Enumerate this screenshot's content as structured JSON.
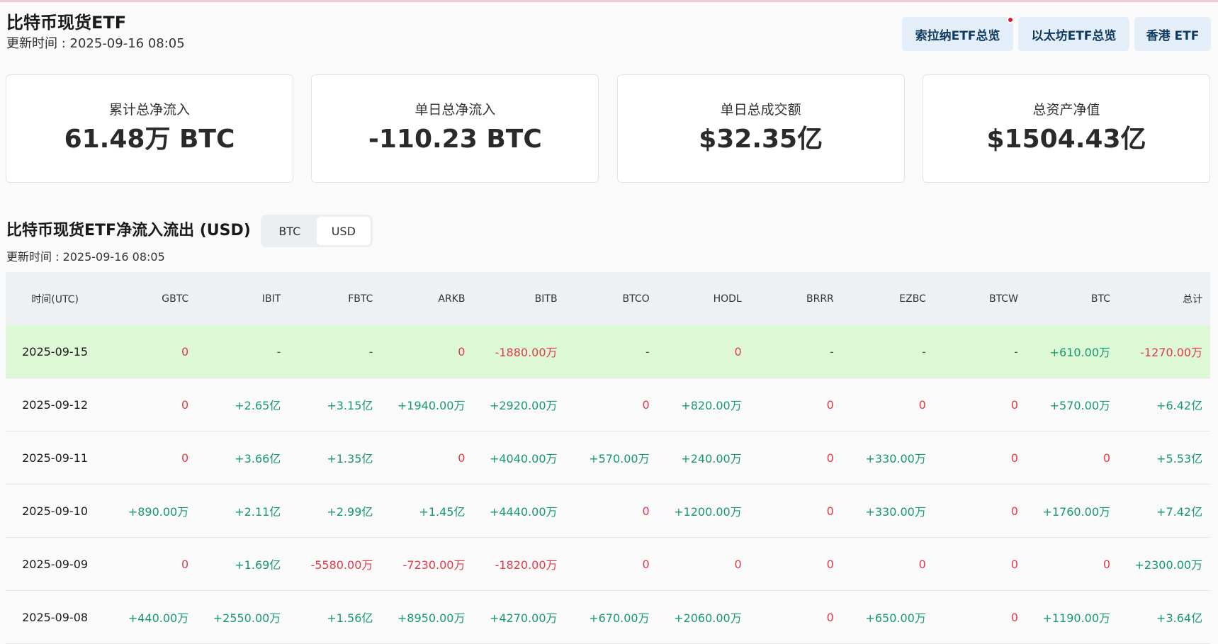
{
  "header": {
    "title": "比特币现货ETF",
    "update_time": "更新时间 : 2025-09-16 08:05"
  },
  "nav": {
    "buttons": [
      "索拉纳ETF总览",
      "以太坊ETF总览",
      "香港 ETF"
    ]
  },
  "stats": [
    {
      "label": "累计总净流入",
      "value": "61.48万 BTC"
    },
    {
      "label": "单日总净流入",
      "value": "-110.23 BTC"
    },
    {
      "label": "单日总成交额",
      "value": "$32.35亿"
    },
    {
      "label": "总资产净值",
      "value": "$1504.43亿"
    }
  ],
  "flows": {
    "title": "比特币现货ETF净流入流出 (USD)",
    "toggle": [
      "BTC",
      "USD"
    ],
    "active_toggle": "USD",
    "update_time": "更新时间 : 2025-09-16 08:05",
    "columns": [
      "时间(UTC)",
      "GBTC",
      "IBIT",
      "FBTC",
      "ARKB",
      "BITB",
      "BTCO",
      "HODL",
      "BRRR",
      "EZBC",
      "BTCW",
      "BTC",
      "总计"
    ],
    "rows": [
      [
        "2025-09-15",
        "0",
        "-",
        "-",
        "0",
        "-1880.00万",
        "-",
        "0",
        "-",
        "-",
        "-",
        "+610.00万",
        "-1270.00万"
      ],
      [
        "2025-09-12",
        "0",
        "+2.65亿",
        "+3.15亿",
        "+1940.00万",
        "+2920.00万",
        "0",
        "+820.00万",
        "0",
        "0",
        "0",
        "+570.00万",
        "+6.42亿"
      ],
      [
        "2025-09-11",
        "0",
        "+3.66亿",
        "+1.35亿",
        "0",
        "+4040.00万",
        "+570.00万",
        "+240.00万",
        "0",
        "+330.00万",
        "0",
        "0",
        "+5.53亿"
      ],
      [
        "2025-09-10",
        "+890.00万",
        "+2.11亿",
        "+2.99亿",
        "+1.45亿",
        "+4440.00万",
        "0",
        "+1200.00万",
        "0",
        "+330.00万",
        "0",
        "+1760.00万",
        "+7.42亿"
      ],
      [
        "2025-09-09",
        "0",
        "+1.69亿",
        "-5580.00万",
        "-7230.00万",
        "-1820.00万",
        "0",
        "0",
        "0",
        "0",
        "0",
        "0",
        "+2300.00万"
      ],
      [
        "2025-09-08",
        "+440.00万",
        "+2550.00万",
        "+1.56亿",
        "+8950.00万",
        "+4270.00万",
        "+670.00万",
        "+2060.00万",
        "0",
        "+650.00万",
        "0",
        "+1190.00万",
        "+3.64亿"
      ]
    ]
  }
}
